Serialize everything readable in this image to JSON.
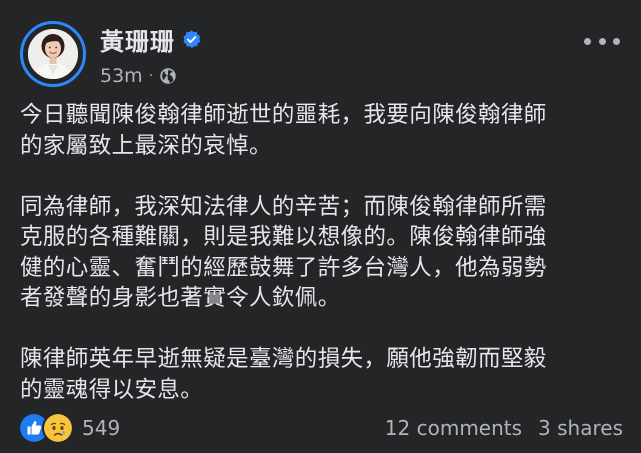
{
  "post": {
    "author": "黃珊珊",
    "timestamp": "53m",
    "separator": "·",
    "audience_icon": "globe-icon",
    "verified_icon": "verified-badge-icon",
    "more_icon": "more-options-icon",
    "paragraphs": [
      [
        "今日聽聞陳俊翰律師逝世的噩耗，我要向陳俊翰律師",
        "的家屬致上最深的哀悼。"
      ],
      [
        "同為律師，我深知法律人的辛苦；而陳俊翰律師所需",
        "克服的各種難關，則是我難以想像的。陳俊翰律師強",
        "健的心靈、奮鬥的經歷鼓舞了許多台灣人，他為弱勢",
        "者發聲的身影也著實令人欽佩。"
      ],
      [
        "陳律師英年早逝無疑是臺灣的損失，願他強韌而堅毅",
        "的靈魂得以安息。"
      ]
    ]
  },
  "footer": {
    "reaction_icons": [
      "like-icon",
      "sad-icon"
    ],
    "reaction_count": "549",
    "comments": "12 comments",
    "shares": "3 shares"
  },
  "colors": {
    "background": "#242526",
    "primary_text": "#e4e6eb",
    "secondary_text": "#b0b3b8",
    "accent_blue": "#2d88ff"
  }
}
